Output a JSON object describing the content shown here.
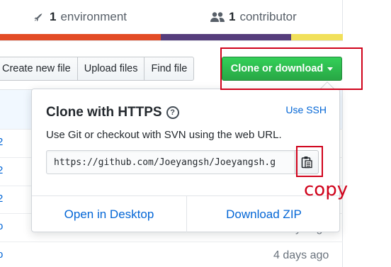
{
  "stats": {
    "environments": {
      "count": "1",
      "label": "environment",
      "icon": "rocket-icon"
    },
    "contributors": {
      "count": "1",
      "label": "contributor",
      "icon": "people-icon"
    }
  },
  "language_bar": [
    {
      "color": "#e34c26",
      "share": 0.47
    },
    {
      "color": "#563d7c",
      "share": 0.38
    },
    {
      "color": "#f1e05a",
      "share": 0.15
    }
  ],
  "file_nav": {
    "create_new_file": "Create new file",
    "upload_files": "Upload files",
    "find_file": "Find file",
    "clone_or_download": "Clone or download"
  },
  "clone_popover": {
    "title": "Clone with HTTPS",
    "help_icon": "question-icon",
    "use_ssh": "Use SSH",
    "description": "Use Git or checkout with SVN using the web URL.",
    "url": "https://github.com/Joeyangsh/Joeyangsh.g",
    "copy_icon": "clipboard-icon",
    "open_in_desktop": "Open in Desktop",
    "download_zip": "Download ZIP"
  },
  "file_list": {
    "rows": [
      {
        "link": "2",
        "age": ""
      },
      {
        "link": "2",
        "age": ""
      },
      {
        "link": "2",
        "age": ""
      },
      {
        "link": "o",
        "age": ""
      },
      {
        "link": "o",
        "age": "4 days ago"
      },
      {
        "link": "o",
        "age": "4 days ago"
      }
    ]
  },
  "annotation": {
    "copy_label": "copy",
    "color": "#d0021b"
  },
  "colors": {
    "accent_link": "#0366d6",
    "clone_green": "#28a745"
  }
}
